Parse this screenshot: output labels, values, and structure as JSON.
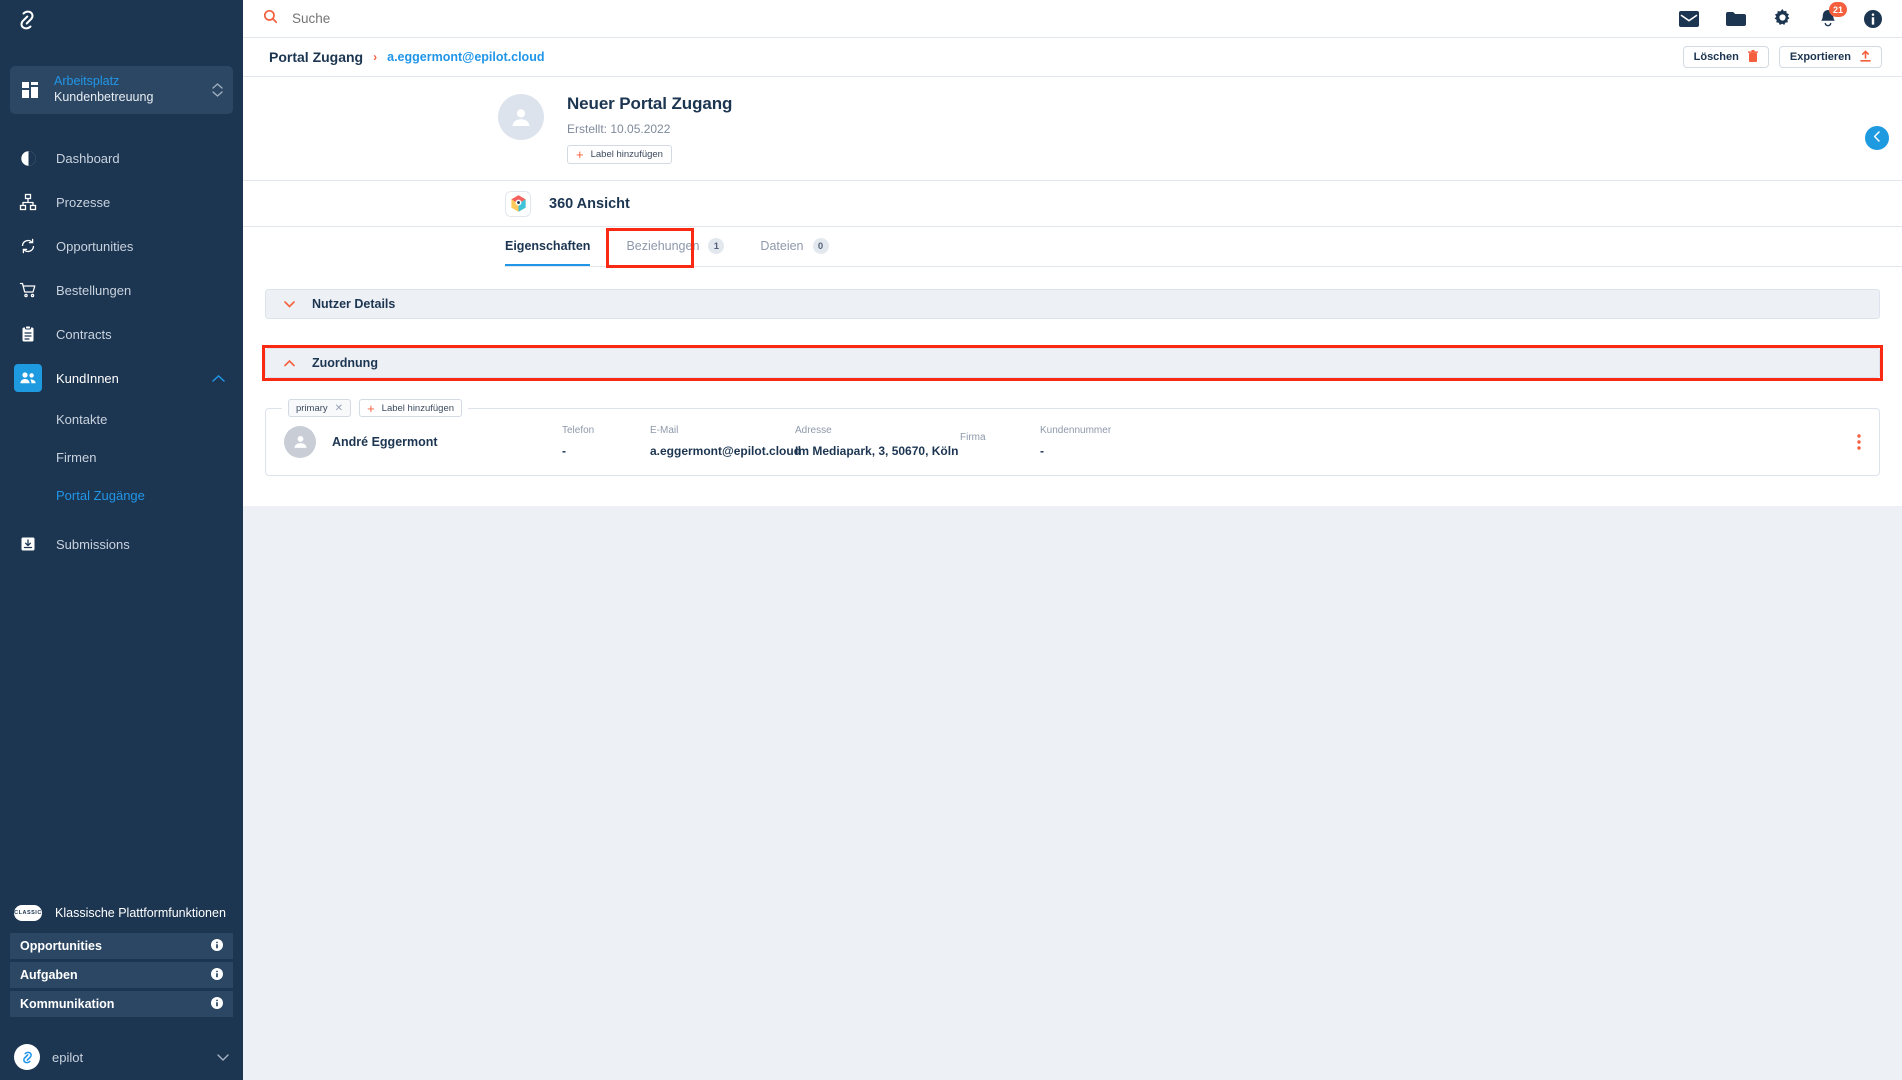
{
  "sidebar": {
    "logo_icon": "epilot-logo-icon",
    "workspace": {
      "icon": "grid-icon",
      "title": "Arbeitsplatz",
      "subtitle": "Kundenbetreuung",
      "chevron_icon": "chevron-updown-icon"
    },
    "nav": [
      {
        "label": "Dashboard",
        "icon": "dashboard-icon",
        "active": false
      },
      {
        "label": "Prozesse",
        "icon": "processes-icon",
        "active": false
      },
      {
        "label": "Opportunities",
        "icon": "opportunities-icon",
        "active": false
      },
      {
        "label": "Bestellungen",
        "icon": "cart-icon",
        "active": false
      },
      {
        "label": "Contracts",
        "icon": "clipboard-icon",
        "active": false
      },
      {
        "label": "KundInnen",
        "icon": "users-icon",
        "active": true
      }
    ],
    "sub_items": [
      {
        "label": "Kontakte",
        "current": false
      },
      {
        "label": "Firmen",
        "current": false
      },
      {
        "label": "Portal Zugänge",
        "current": true
      }
    ],
    "nav_after": [
      {
        "label": "Submissions",
        "icon": "submissions-icon",
        "active": false
      }
    ],
    "classic": {
      "pill": "CLASSIC",
      "title": "Klassische Plattformfunktionen",
      "rows": [
        {
          "label": "Opportunities",
          "info_icon": "info-icon"
        },
        {
          "label": "Aufgaben",
          "info_icon": "info-icon"
        },
        {
          "label": "Kommunikation",
          "info_icon": "info-icon"
        }
      ]
    },
    "account": {
      "name": "epilot",
      "avatar_icon": "epilot-avatar-icon",
      "chevron_icon": "chevron-down-icon"
    }
  },
  "topbar": {
    "search": {
      "icon": "search-icon",
      "placeholder": "Suche",
      "value": ""
    },
    "icons": [
      {
        "name": "mail-icon",
        "badge": null
      },
      {
        "name": "folder-icon",
        "badge": null
      },
      {
        "name": "gear-icon",
        "badge": null
      },
      {
        "name": "bell-icon",
        "badge": "21"
      },
      {
        "name": "info-icon",
        "badge": null
      }
    ]
  },
  "breadcrumb": {
    "root": "Portal Zugang",
    "separator": "›",
    "current": "a.eggermont@epilot.cloud",
    "actions": [
      {
        "label": "Löschen",
        "icon": "trash-icon"
      },
      {
        "label": "Exportieren",
        "icon": "upload-icon"
      }
    ]
  },
  "record": {
    "avatar_icon": "person-avatar-icon",
    "title": "Neuer Portal Zugang",
    "meta": "Erstellt: 10.05.2022",
    "add_label_button": "Label hinzufügen"
  },
  "view": {
    "icon": "360-view-icon",
    "title": "360 Ansicht"
  },
  "tabs": [
    {
      "label": "Eigenschaften",
      "count": null,
      "active": true
    },
    {
      "label": "Beziehungen",
      "count": "1",
      "active": false,
      "highlighted": true
    },
    {
      "label": "Dateien",
      "count": "0",
      "active": false
    }
  ],
  "accordions": [
    {
      "label": "Nutzer Details",
      "expanded": false,
      "chevron_icon": "chevron-down-icon",
      "highlighted": false
    },
    {
      "label": "Zuordnung",
      "expanded": true,
      "chevron_icon": "chevron-up-icon",
      "highlighted": true
    }
  ],
  "relation_card": {
    "tag": {
      "label": "primary",
      "remove_icon": "close-icon"
    },
    "add_label_button": "Label hinzufügen",
    "avatar_icon": "person-avatar-icon",
    "name": "André Eggermont",
    "fields": [
      {
        "label": "Telefon",
        "value": "-"
      },
      {
        "label": "E-Mail",
        "value": "a.eggermont@epilot.cloud"
      },
      {
        "label": "Adresse",
        "value": "Im Mediapark, 3, 50670, Köln"
      },
      {
        "label": "Firma",
        "value": ""
      },
      {
        "label": "Kundennummer",
        "value": "-"
      }
    ],
    "menu_icon": "more-vertical-icon"
  },
  "collapse_button": {
    "icon": "chevron-left-icon"
  },
  "colors": {
    "sidebar_bg": "#1c3551",
    "accent_blue": "#2196e8",
    "accent_orange": "#f4603e",
    "highlight_red": "#fa2a12",
    "page_bg": "#edf0f4"
  }
}
